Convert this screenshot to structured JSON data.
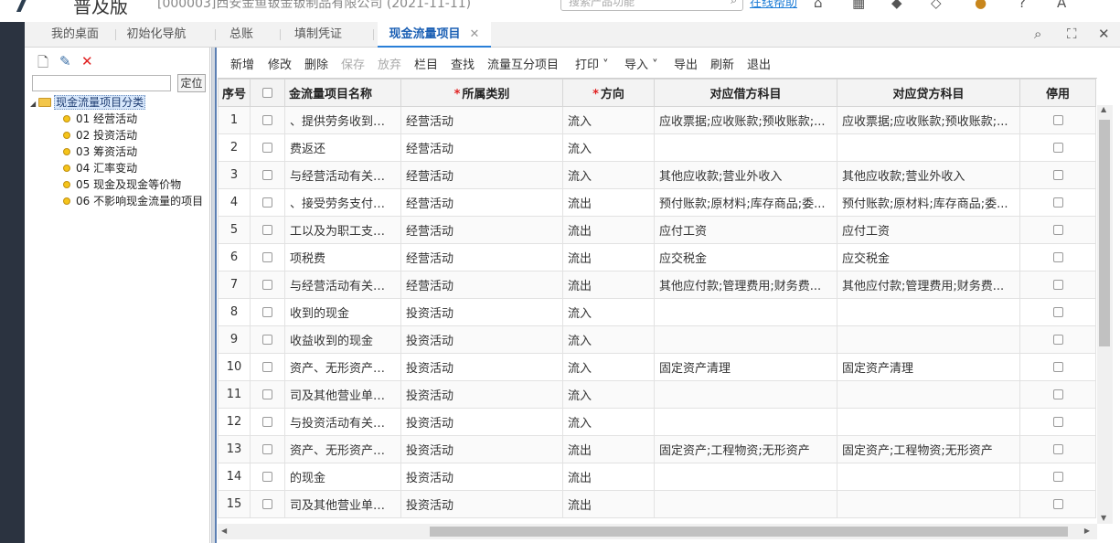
{
  "app": {
    "product": "普及版",
    "company": "[000003]西安金鱼钣金钣制品有限公司 (2021-11-11)",
    "search_placeholder": "搜索产品功能",
    "help_link": "在线帮助"
  },
  "tabs": [
    {
      "label": "我的桌面"
    },
    {
      "label": "初始化导航"
    },
    {
      "label": "总账"
    },
    {
      "label": "填制凭证"
    },
    {
      "label": "现金流量项目",
      "active": true
    }
  ],
  "left": {
    "locate_label": "定位",
    "tree_root": "现金流量项目分类",
    "tree_items": [
      "01 经营活动",
      "02 投资活动",
      "03 筹资活动",
      "04 汇率变动",
      "05 现金及现金等价物",
      "06 不影响现金流量的项目"
    ]
  },
  "toolbar": {
    "new": "新增",
    "edit": "修改",
    "delete": "删除",
    "save": "保存",
    "discard": "放弃",
    "columns": "栏目",
    "find": "查找",
    "exchange": "流量互分项目",
    "print": "打印",
    "import": "导入",
    "export": "导出",
    "refresh": "刷新",
    "exit": "退出"
  },
  "table": {
    "headers": {
      "seq": "序号",
      "name": "金流量项目名称",
      "category": "所属类别",
      "direction": "方向",
      "debit": "对应借方科目",
      "credit": "对应贷方科目",
      "disabled": "停用"
    },
    "rows": [
      {
        "seq": "1",
        "name": "、提供劳务收到的现金",
        "category": "经营活动",
        "direction": "流入",
        "debit": "应收票据;应收账款;预收账款;...",
        "credit": "应收票据;应收账款;预收账款;..."
      },
      {
        "seq": "2",
        "name": "费返还",
        "category": "经营活动",
        "direction": "流入",
        "debit": "",
        "credit": ""
      },
      {
        "seq": "3",
        "name": "与经营活动有关的现金",
        "category": "经营活动",
        "direction": "流入",
        "debit": "其他应收款;营业外收入",
        "credit": "其他应收款;营业外收入"
      },
      {
        "seq": "4",
        "name": "、接受劳务支付的现金",
        "category": "经营活动",
        "direction": "流出",
        "debit": "预付账款;原材料;库存商品;委...",
        "credit": "预付账款;原材料;库存商品;委..."
      },
      {
        "seq": "5",
        "name": "工以及为职工支付的现金",
        "category": "经营活动",
        "direction": "流出",
        "debit": "应付工资",
        "credit": "应付工资"
      },
      {
        "seq": "6",
        "name": "项税费",
        "category": "经营活动",
        "direction": "流出",
        "debit": "应交税金",
        "credit": "应交税金"
      },
      {
        "seq": "7",
        "name": "与经营活动有关的现金",
        "category": "经营活动",
        "direction": "流出",
        "debit": "其他应付款;管理费用;财务费...",
        "credit": "其他应付款;管理费用;财务费..."
      },
      {
        "seq": "8",
        "name": "收到的现金",
        "category": "投资活动",
        "direction": "流入",
        "debit": "",
        "credit": ""
      },
      {
        "seq": "9",
        "name": "收益收到的现金",
        "category": "投资活动",
        "direction": "流入",
        "debit": "",
        "credit": ""
      },
      {
        "seq": "10",
        "name": "资产、无形资产和其他长期资产",
        "category": "投资活动",
        "direction": "流入",
        "debit": "固定资产清理",
        "credit": "固定资产清理"
      },
      {
        "seq": "11",
        "name": "司及其他营业单位收到的现金",
        "category": "投资活动",
        "direction": "流入",
        "debit": "",
        "credit": ""
      },
      {
        "seq": "12",
        "name": "与投资活动有关的现金",
        "category": "投资活动",
        "direction": "流入",
        "debit": "",
        "credit": ""
      },
      {
        "seq": "13",
        "name": "资产、无形资产和其他长期资产",
        "category": "投资活动",
        "direction": "流出",
        "debit": "固定资产;工程物资;无形资产",
        "credit": "固定资产;工程物资;无形资产"
      },
      {
        "seq": "14",
        "name": "的现金",
        "category": "投资活动",
        "direction": "流出",
        "debit": "",
        "credit": ""
      },
      {
        "seq": "15",
        "name": "司及其他营业单位支付的现金",
        "category": "投资活动",
        "direction": "流出",
        "debit": "",
        "credit": ""
      }
    ]
  },
  "colors": {
    "accent": "#2a7fd8",
    "sidebar": "#2b3340",
    "required": "#e02020"
  }
}
